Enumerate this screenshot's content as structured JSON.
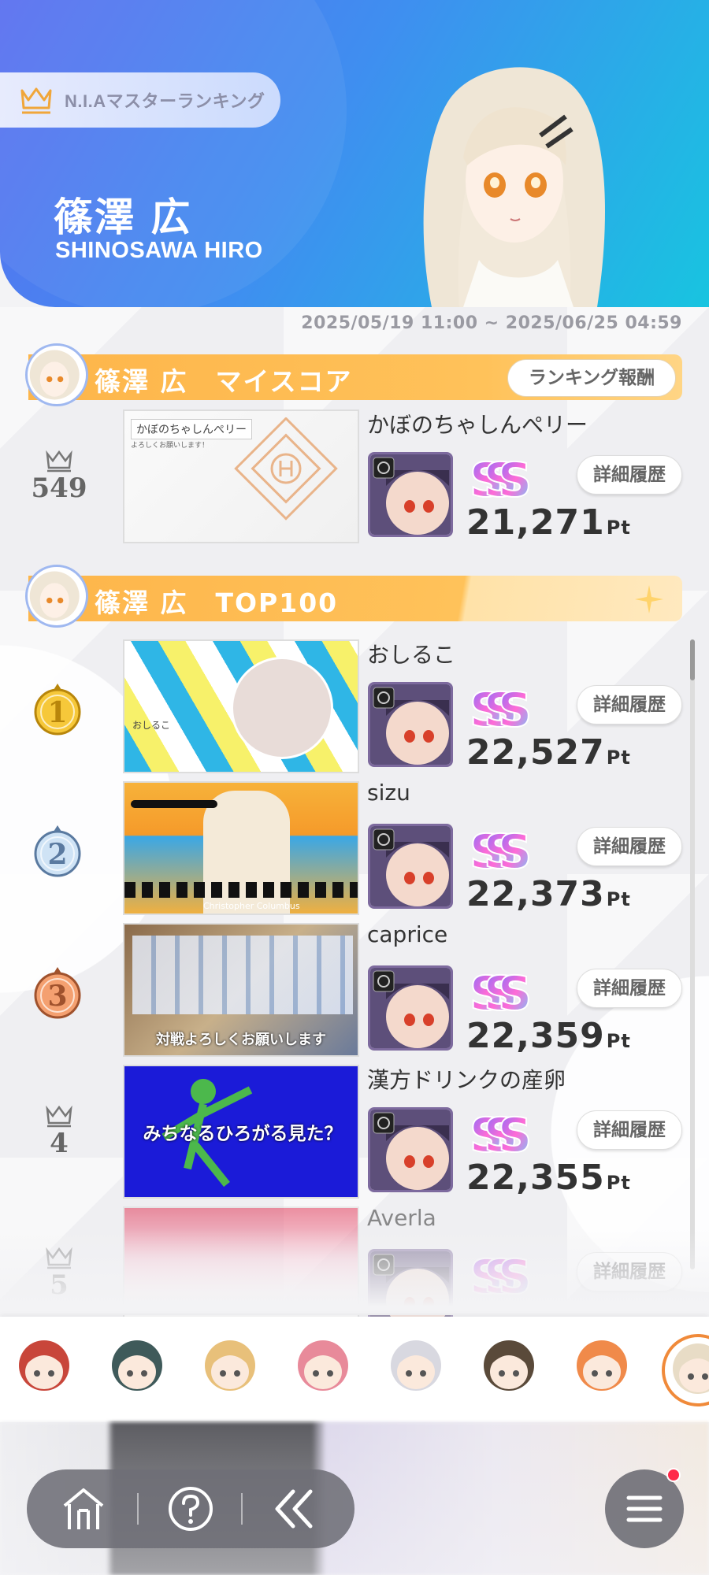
{
  "header": {
    "ranking_title": "N.I.Aマスターランキング",
    "character_name_jp": "篠澤 広",
    "character_name_en": "SHINOSAWA HIRO",
    "period": "2025/05/19 11:00 ~ 2025/06/25 04:59"
  },
  "my_score": {
    "section_title": "篠澤 広　マイスコア",
    "reward_button": "ランキング報酬",
    "rank": "549",
    "player_name": "かぼのちゃしんぺリー",
    "thumb_text": "かぼのちゃしんぺリー",
    "thumb_subtext": "よろしくお願いします！",
    "score": "21,271",
    "unit": "Pt",
    "detail_button": "詳細履歴"
  },
  "top100": {
    "section_title": "篠澤 広　TOP100",
    "entries": [
      {
        "rank": "1",
        "player_name": "おしるこ",
        "score": "22,527",
        "unit": "Pt",
        "detail_button": "詳細履歴",
        "thumb_text": "おしるこ"
      },
      {
        "rank": "2",
        "player_name": "sizu",
        "score": "22,373",
        "unit": "Pt",
        "detail_button": "詳細履歴",
        "thumb_text": "Christopher Columbus"
      },
      {
        "rank": "3",
        "player_name": "caprice",
        "score": "22,359",
        "unit": "Pt",
        "detail_button": "詳細履歴",
        "thumb_text": "対戦よろしくお願いします"
      },
      {
        "rank": "4",
        "player_name": "漢方ドリンクの産卵",
        "score": "22,355",
        "unit": "Pt",
        "detail_button": "詳細履歴",
        "thumb_text": "みちなるひろがる見た？"
      },
      {
        "rank": "5",
        "player_name": "Averla",
        "score": "",
        "unit": "",
        "detail_button": "詳細履歴",
        "thumb_text": ""
      }
    ]
  },
  "grade_label": "SSS",
  "character_bar": {
    "icons": [
      "character-1-icon",
      "character-2-icon",
      "character-3-icon",
      "character-4-icon",
      "character-5-icon",
      "character-6-icon",
      "character-7-icon",
      "character-8-icon"
    ],
    "selected_index": 7
  },
  "nav": {
    "icons": [
      "home-icon",
      "help-icon",
      "back-icon",
      "menu-icon"
    ]
  },
  "colors": {
    "header_start": "#5a6ff0",
    "header_end": "#18c4e0",
    "section_bar": "#fdb54a",
    "selected_ring": "#f08a3a",
    "notification": "#ff2a4a"
  }
}
